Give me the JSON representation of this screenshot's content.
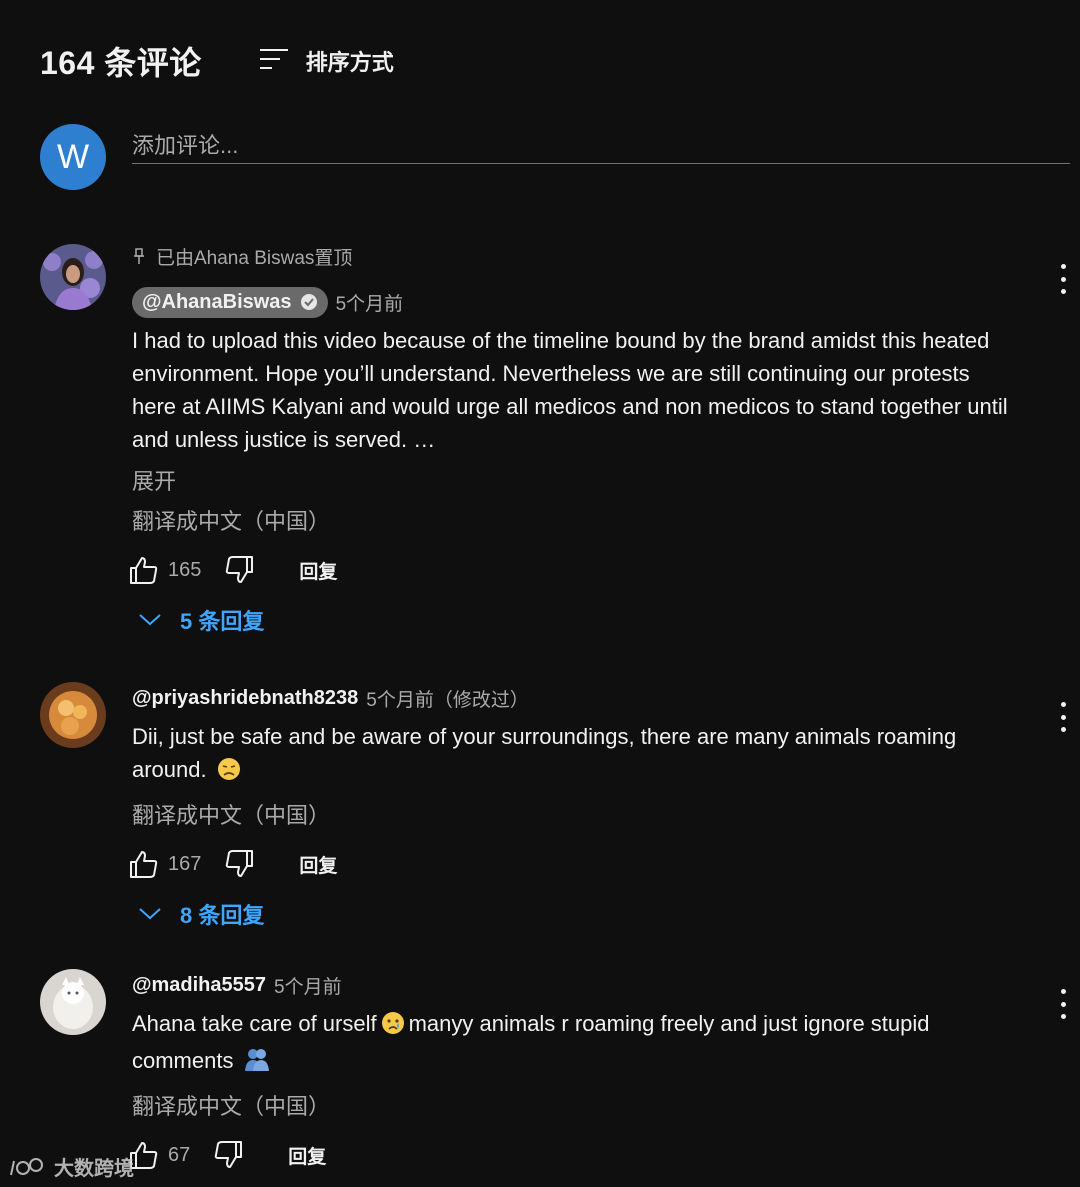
{
  "header": {
    "count_label": "164 条评论",
    "sort_label": "排序方式"
  },
  "add_comment": {
    "avatar_letter": "W",
    "placeholder": "添加评论..."
  },
  "comments": [
    {
      "pinned_label": "已由Ahana Biswas置顶",
      "author": "@AhanaBiswas",
      "verified": true,
      "time": "5个月前",
      "text": "I had to upload this video because of the timeline bound by the brand amidst this heated environment. Hope you’ll understand. Nevertheless we are still continuing our protests here at AIIMS Kalyani and would urge all medicos and non medicos to stand together until and unless justice is served. …",
      "expand_label": "展开",
      "translate_label": "翻译成中文（中国）",
      "likes": "165",
      "reply_label": "回复",
      "replies_label": "5 条回复"
    },
    {
      "author": "@priyashridebnath8238",
      "time": "5个月前（修改过）",
      "text": "Dii, just be safe and be aware of your surroundings, there are many animals roaming around.",
      "emoji": "disappointed-face",
      "translate_label": "翻译成中文（中国）",
      "likes": "167",
      "reply_label": "回复",
      "replies_label": "8 条回复"
    },
    {
      "author": "@madiha5557",
      "time": "5个月前",
      "text_part1": "Ahana take care of urself",
      "text_part2": "manyy animals r roaming freely and just ignore stupid comments",
      "emoji1": "crying-face",
      "emoji2": "people-hugging",
      "translate_label": "翻译成中文（中国）",
      "likes": "67",
      "reply_label": "回复"
    }
  ],
  "watermark": "大数跨境",
  "colors": {
    "background": "#0f0f0f",
    "link_blue": "#3ea6ff",
    "avatar_blue": "#2f7fd1",
    "muted": "#aaaaaa"
  }
}
